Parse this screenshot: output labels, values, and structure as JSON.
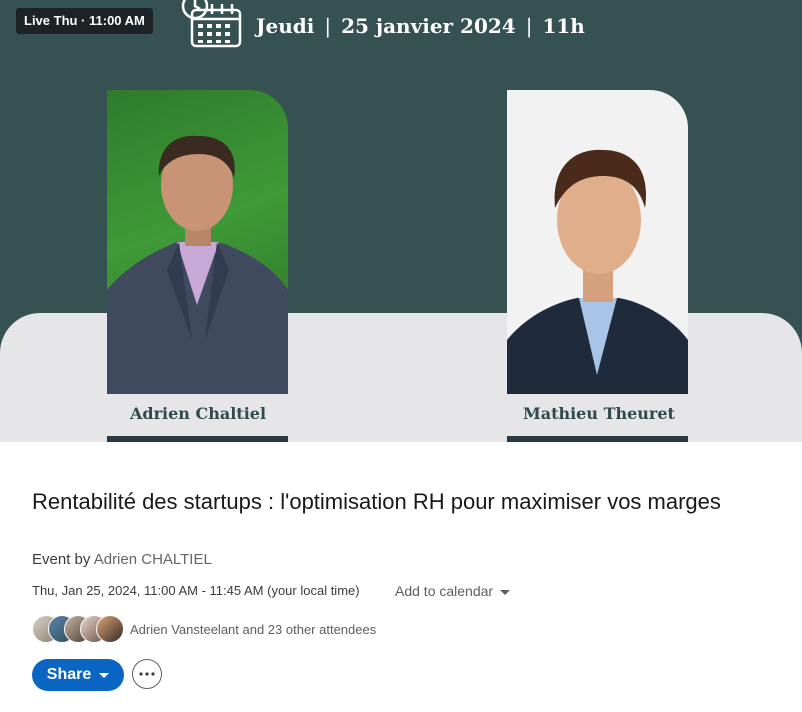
{
  "banner": {
    "live_badge": "Live Thu · 11:00 AM",
    "day": "Jeudi",
    "date": "25 janvier 2024",
    "hour": "11h",
    "separator": "|",
    "speaker_left": "Adrien Chaltiel",
    "speaker_right": "Mathieu Theuret",
    "colors": {
      "banner_bg": "#365151",
      "band_bg": "#e6e6e8",
      "name_color": "#2e4b4b"
    }
  },
  "event": {
    "title": "Rentabilité des startups : l'optimisation RH pour maximiser vos marges",
    "organizer_prefix": "Event by",
    "organizer_name": "Adrien CHALTIEL",
    "datetime": "Thu, Jan 25, 2024, 11:00 AM - 11:45 AM (your local time)",
    "add_to_calendar": "Add to calendar",
    "attendees_text": "Adrien Vansteelant and 23 other attendees"
  },
  "actions": {
    "share_label": "Share",
    "more_icon": "ellipsis-icon",
    "accent": "#0a66c2"
  }
}
